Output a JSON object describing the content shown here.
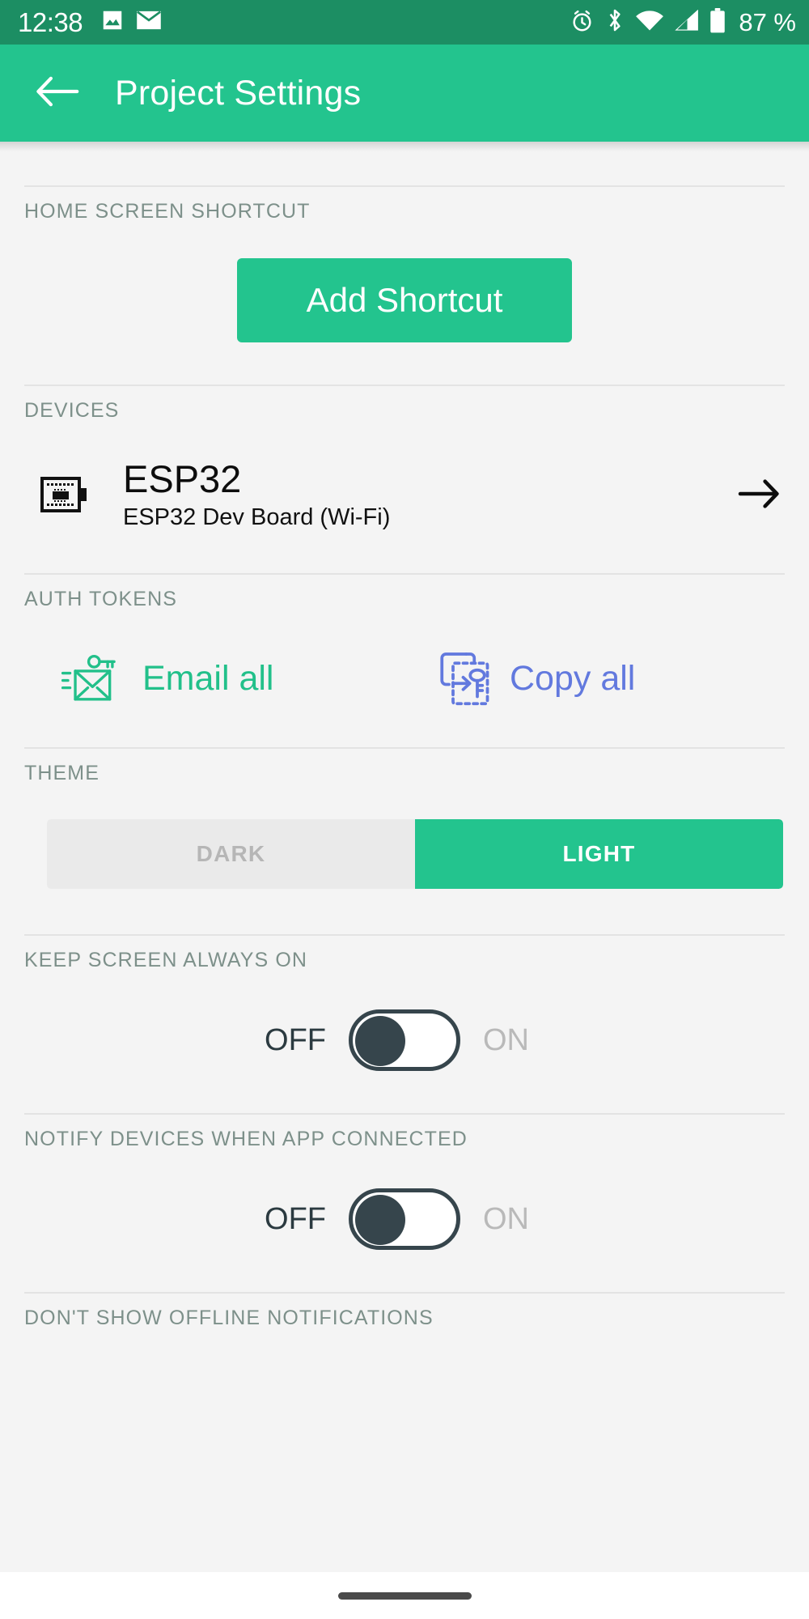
{
  "status_bar": {
    "time": "12:38",
    "battery_percent": "87 %",
    "left_icons": [
      "photo-icon",
      "envelope-icon"
    ],
    "right_icons": [
      "alarm-icon",
      "bluetooth-icon",
      "wifi-icon",
      "cell-signal-icon",
      "battery-icon"
    ],
    "background_color": "#1c8e63"
  },
  "app_bar": {
    "back_icon": "arrow-left-icon",
    "title": "Project Settings",
    "background_color": "#23c48e"
  },
  "sections": {
    "home_shortcut": {
      "label": "HOME SCREEN SHORTCUT",
      "button_label": "Add Shortcut"
    },
    "devices": {
      "label": "DEVICES",
      "items": [
        {
          "icon": "dev-board-icon",
          "name": "ESP32",
          "subtitle": "ESP32 Dev Board (Wi-Fi)",
          "chevron": "arrow-right-icon"
        }
      ]
    },
    "auth_tokens": {
      "label": "AUTH TOKENS",
      "actions": [
        {
          "icon": "mail-key-icon",
          "label": "Email all",
          "color": "#22c08a"
        },
        {
          "icon": "copy-key-icon",
          "label": "Copy all",
          "color": "#6279de"
        }
      ]
    },
    "theme": {
      "label": "THEME",
      "options": [
        "DARK",
        "LIGHT"
      ],
      "selected": "LIGHT",
      "active_color": "#23c48e",
      "inactive_color": "#eaeaea"
    },
    "keep_screen_on": {
      "label": "KEEP SCREEN ALWAYS ON",
      "off_label": "OFF",
      "on_label": "ON",
      "state": "OFF"
    },
    "notify_devices": {
      "label": "NOTIFY DEVICES WHEN APP CONNECTED",
      "off_label": "OFF",
      "on_label": "ON",
      "state": "OFF"
    },
    "offline_notifications": {
      "label": "DON'T SHOW OFFLINE NOTIFICATIONS"
    }
  },
  "nav_bar": {
    "gesture_pill": "home-gesture-pill"
  }
}
